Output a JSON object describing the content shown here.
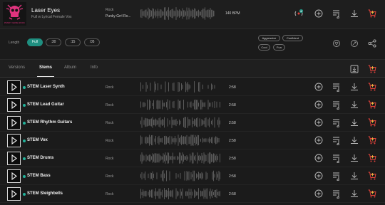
{
  "track": {
    "title": "Laser Eyes",
    "subtitle": "Full w Lyrical Female Vox",
    "genre": "Rock",
    "artist": "Punky Grrl Ro...",
    "bpm": "140 BPM",
    "art_caption": "PUNKY GRRL ROCK"
  },
  "header_icons": [
    "broadcast-icon",
    "add-icon",
    "add-to-playlist-icon",
    "download-icon",
    "cart-icon"
  ],
  "length": {
    "label": "Length",
    "options": [
      "Full",
      ":30",
      ":15",
      ":05"
    ],
    "selected": "Full"
  },
  "tags": [
    "Aggressive",
    "Confident",
    "Cool",
    "Fun"
  ],
  "tabs": [
    {
      "label": "Versions",
      "active": false
    },
    {
      "label": "Stems",
      "active": true
    },
    {
      "label": "Album",
      "active": false
    },
    {
      "label": "Info",
      "active": false
    }
  ],
  "stems": [
    {
      "name": "STEM Laser Synth",
      "genre": "Rock",
      "duration": "2:58"
    },
    {
      "name": "STEM Lead Guitar",
      "genre": "Rock",
      "duration": "2:58"
    },
    {
      "name": "STEM Rhythm Guitars",
      "genre": "Rock",
      "duration": "2:58"
    },
    {
      "name": "STEM Vox",
      "genre": "Rock",
      "duration": "2:58"
    },
    {
      "name": "STEM Drums",
      "genre": "Rock",
      "duration": "2:58"
    },
    {
      "name": "STEM Bass",
      "genre": "Rock",
      "duration": "2:58"
    },
    {
      "name": "STEM Sleighbells",
      "genre": "Rock",
      "duration": "2:58"
    }
  ],
  "colors": {
    "accent": "#1f8f80",
    "status_dot": "#22b39c",
    "cart": "#e0413a",
    "background": "#1b1b1b"
  }
}
